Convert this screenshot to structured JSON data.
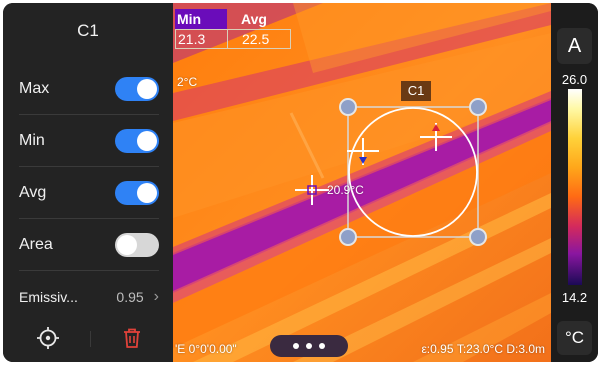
{
  "panel": {
    "title": "C1",
    "items": [
      {
        "label": "Max",
        "state": "on"
      },
      {
        "label": "Min",
        "state": "on"
      },
      {
        "label": "Avg",
        "state": "on"
      },
      {
        "label": "Area",
        "state": "off"
      }
    ],
    "emissivity": {
      "label": "Emissiv...",
      "value": "0.95",
      "chevron": "›"
    },
    "bottom_icons": [
      "crosshair-icon",
      "trash-icon"
    ]
  },
  "measurement": {
    "min_label": "Min",
    "avg_label": "Avg",
    "min_value": "21.3",
    "avg_value": "22.5",
    "edge_temp": "2°C",
    "center_temp": "20.9°C",
    "box_label": "C1"
  },
  "status": {
    "coords": "'E 0°0'0.00\"",
    "params": "ε:0.95  T:23.0°C  D:3.0m"
  },
  "scale": {
    "mode": "A",
    "max": "26.0",
    "min": "14.2",
    "unit": "°C"
  },
  "colors": {
    "toggle_on": "#2f82f5",
    "toggle_off": "#d7d7d7",
    "delete_icon": "#e0423a",
    "min_header": "#6a0cba"
  }
}
